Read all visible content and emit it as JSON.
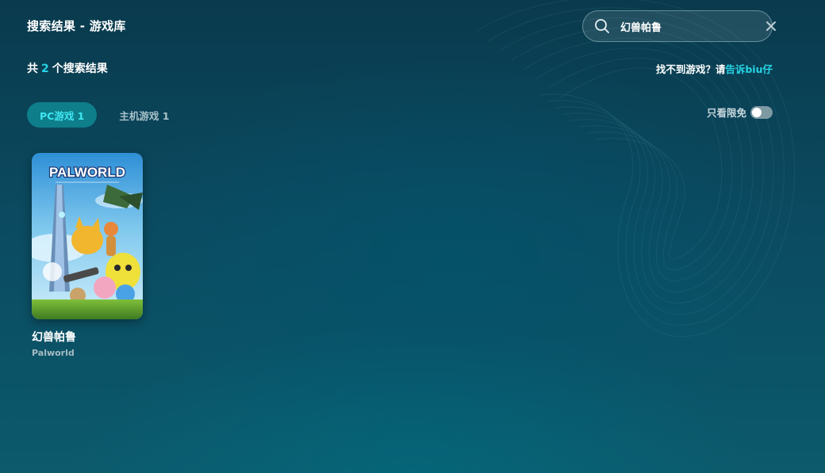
{
  "header": {
    "title": "搜索结果 - 游戏库"
  },
  "search": {
    "value": "幻兽帕鲁",
    "icon": "search-icon",
    "clear_icon": "close-icon"
  },
  "summary": {
    "prefix": "共",
    "count": "2",
    "suffix": "个搜索结果"
  },
  "feedback": {
    "text": "找不到游戏？请",
    "link": "告诉biu仔"
  },
  "tabs": [
    {
      "label": "PC游戏 1",
      "active": true
    },
    {
      "label": "主机游戏 1",
      "active": false
    }
  ],
  "filter": {
    "label": "只看限免",
    "enabled": false
  },
  "results": [
    {
      "cover_logo": "PALWORLD",
      "title": "幻兽帕鲁",
      "subtitle": "Palworld"
    }
  ],
  "colors": {
    "accent": "#25d5e6",
    "tab_active_bg": "#0e7e8a",
    "background": "#0b4a60"
  }
}
